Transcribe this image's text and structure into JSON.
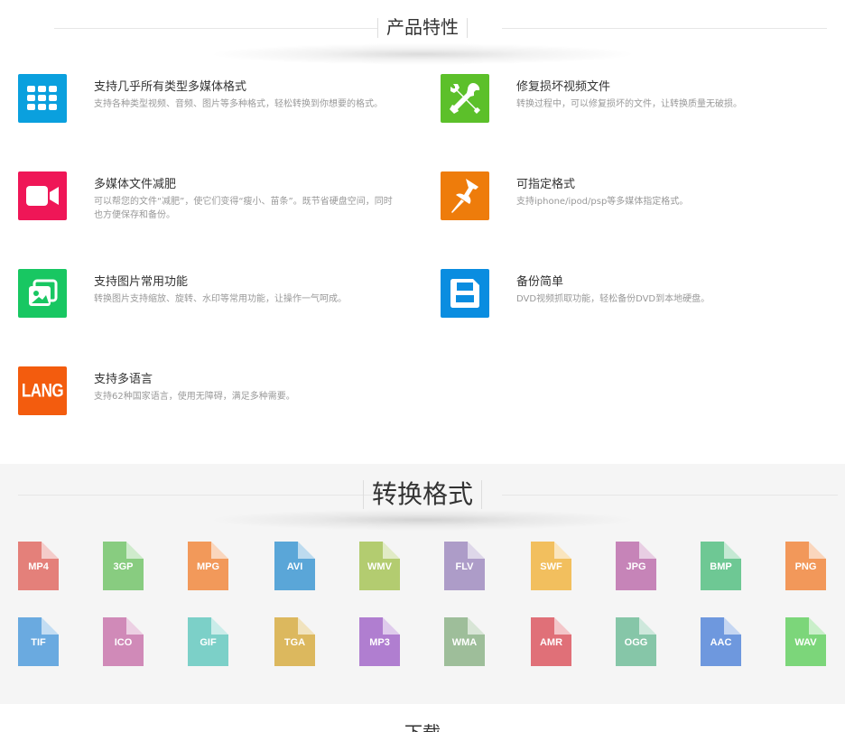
{
  "features_section": {
    "title": "产品特性",
    "items": [
      {
        "title": "支持几乎所有类型多媒体格式",
        "desc": "支持各种类型视频、音频、图片等多种格式，轻松转换到你想要的格式。",
        "icon": "grid-icon",
        "color": "#0aa0de"
      },
      {
        "title": "修复损坏视频文件",
        "desc": "转换过程中，可以修复损坏的文件，让转换质量无破损。",
        "icon": "tools-icon",
        "color": "#5cc02a"
      },
      {
        "title": "多媒体文件减肥",
        "desc": "可以帮您的文件“减肥”，使它们变得“瘦小、苗条”。既节省硬盘空间，同时也方便保存和备份。",
        "icon": "video-camera-icon",
        "color": "#ef1657"
      },
      {
        "title": "可指定格式",
        "desc": "支持iphone/ipod/psp等多媒体指定格式。",
        "icon": "pin-icon",
        "color": "#ee7c0b"
      },
      {
        "title": "支持图片常用功能",
        "desc": "转换图片支持缩放、旋转、水印等常用功能，让操作一气呵成。",
        "icon": "pictures-icon",
        "color": "#18c762"
      },
      {
        "title": "备份简单",
        "desc": "DVD视频抓取功能，轻松备份DVD到本地硬盘。",
        "icon": "floppy-disk-icon",
        "color": "#0a8de0"
      },
      {
        "title": "支持多语言",
        "desc": "支持62种国家语言，使用无障碍，满足多种需要。",
        "icon": "lang-icon",
        "icon_text": "LANG",
        "color": "#f35c0e"
      }
    ]
  },
  "formats_section": {
    "title": "转换格式",
    "formats": [
      {
        "ext": "MP4",
        "color": "#e4807a"
      },
      {
        "ext": "3GP",
        "color": "#88cc80"
      },
      {
        "ext": "MPG",
        "color": "#f2995a"
      },
      {
        "ext": "AVI",
        "color": "#5aa6d8"
      },
      {
        "ext": "WMV",
        "color": "#b3cc70"
      },
      {
        "ext": "FLV",
        "color": "#ad9cc8"
      },
      {
        "ext": "SWF",
        "color": "#f2bf5e"
      },
      {
        "ext": "JPG",
        "color": "#c684b8"
      },
      {
        "ext": "BMP",
        "color": "#6ec894"
      },
      {
        "ext": "PNG",
        "color": "#f2985a"
      },
      {
        "ext": "TIF",
        "color": "#6aaae0"
      },
      {
        "ext": "ICO",
        "color": "#d08ab8"
      },
      {
        "ext": "GIF",
        "color": "#7cd0c8"
      },
      {
        "ext": "TGA",
        "color": "#dcb85e"
      },
      {
        "ext": "MP3",
        "color": "#b07ed0"
      },
      {
        "ext": "WMA",
        "color": "#9ebe9a"
      },
      {
        "ext": "AMR",
        "color": "#e07078"
      },
      {
        "ext": "OGG",
        "color": "#86c6a8"
      },
      {
        "ext": "AAC",
        "color": "#6e98de"
      },
      {
        "ext": "WAV",
        "color": "#7cd67a"
      }
    ]
  },
  "bottom_section": {
    "title": "下载"
  }
}
